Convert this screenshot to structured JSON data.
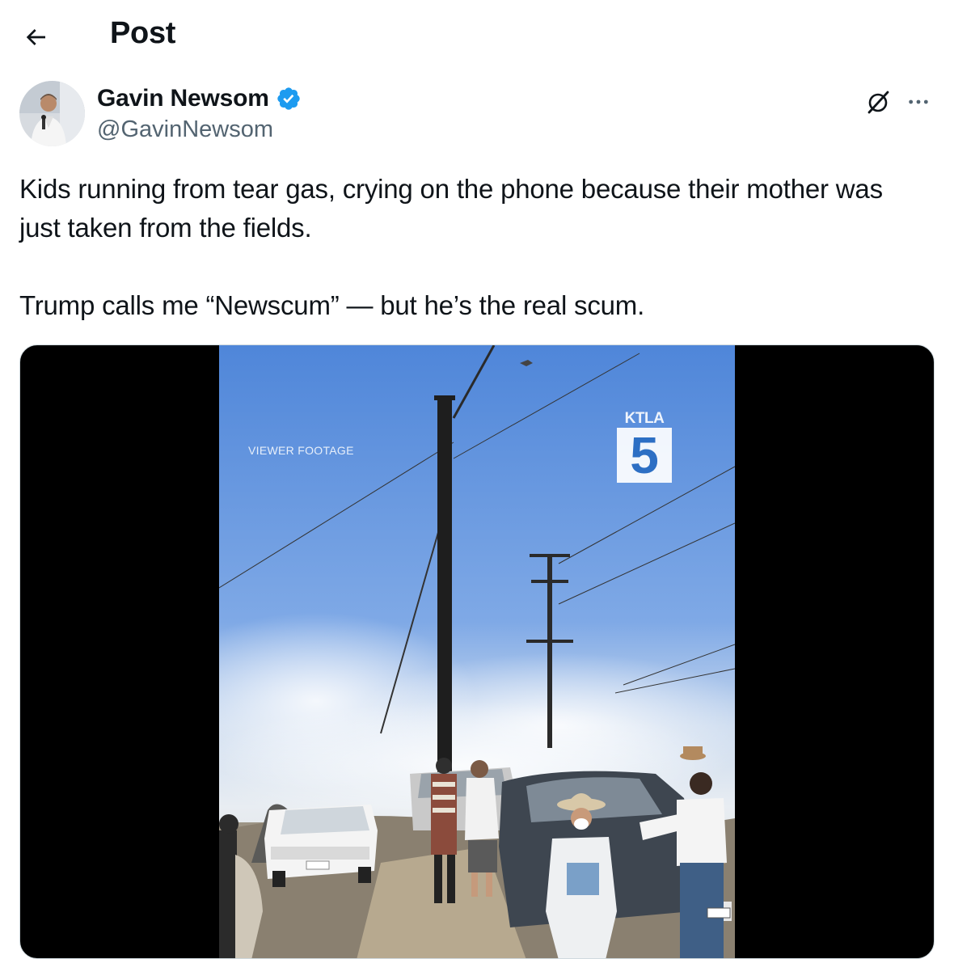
{
  "header": {
    "back_icon": "arrow-left-icon",
    "title": "Post"
  },
  "author": {
    "name": "Gavin Newsom",
    "handle": "@GavinNewsom",
    "verified": true,
    "verified_color": "#1d9bf0",
    "avatar_icon": "profile-photo"
  },
  "actions": {
    "grok_icon": "grok-icon",
    "more_icon": "more-horizontal-icon"
  },
  "post": {
    "paragraph_1": "Kids running from tear gas, crying on the phone because their mother was just taken from the fields.",
    "paragraph_2": "Trump calls me “Newscum” — but he’s the real scum."
  },
  "media": {
    "type": "video",
    "overlay_label": "VIEWER FOOTAGE",
    "logo_text": "KTLA",
    "logo_number": "5"
  }
}
